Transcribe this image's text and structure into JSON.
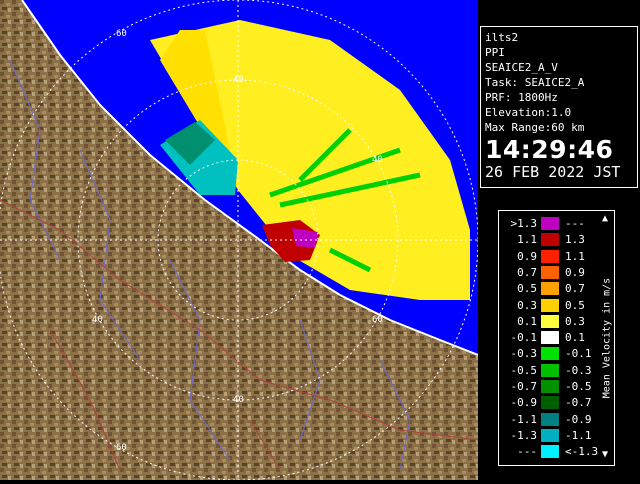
{
  "info": {
    "site": "ilts2",
    "scan_type": "PPI",
    "product": "SEAICE2_A_V",
    "task": "Task: SEAICE2_A",
    "prf": "PRF: 1800Hz",
    "elevation": "Elevation:1.0",
    "max_range": "Max Range:60 km",
    "time": "14:29:46",
    "date": "26 FEB 2022 JST"
  },
  "radar": {
    "ring_labels": [
      "60",
      "40",
      "40",
      "40",
      "40",
      "60",
      "60"
    ]
  },
  "legend": {
    "title": "Mean Velocity in m/s",
    "top_marker": "▲",
    "bottom_marker": "▼",
    "rows": [
      {
        "low": ">1.3",
        "high": "---",
        "color": "#c000c0"
      },
      {
        "low": "1.1",
        "high": "1.3",
        "color": "#c00000"
      },
      {
        "low": "0.9",
        "high": "1.1",
        "color": "#ff2000"
      },
      {
        "low": "0.7",
        "high": "0.9",
        "color": "#ff6000"
      },
      {
        "low": "0.5",
        "high": "0.7",
        "color": "#ffa000"
      },
      {
        "low": "0.3",
        "high": "0.5",
        "color": "#ffd000"
      },
      {
        "low": "0.1",
        "high": "0.3",
        "color": "#ffff40"
      },
      {
        "low": "-0.1",
        "high": "0.1",
        "color": "#ffffff"
      },
      {
        "low": "-0.3",
        "high": "-0.1",
        "color": "#00e000"
      },
      {
        "low": "-0.5",
        "high": "-0.3",
        "color": "#00c000"
      },
      {
        "low": "-0.7",
        "high": "-0.5",
        "color": "#009000"
      },
      {
        "low": "-0.9",
        "high": "-0.7",
        "color": "#006000"
      },
      {
        "low": "-1.1",
        "high": "-0.9",
        "color": "#008080"
      },
      {
        "low": "-1.3",
        "high": "-1.1",
        "color": "#00b0c0"
      },
      {
        "low": "---",
        "high": "<-1.3",
        "color": "#00f0ff"
      }
    ]
  },
  "colors": {
    "sea": "#0000ff",
    "terrain": "#8a6e46",
    "coast": "#ffffff"
  }
}
